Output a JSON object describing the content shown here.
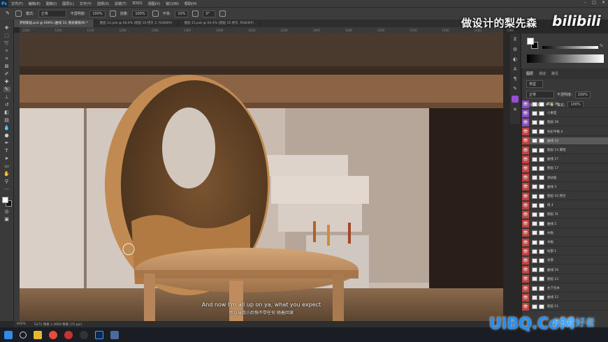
{
  "app": {
    "name": "Ps"
  },
  "menu": [
    "文件(F)",
    "编辑(E)",
    "图像(I)",
    "图层(L)",
    "文字(Y)",
    "选择(S)",
    "滤镜(T)",
    "3D(D)",
    "视图(V)",
    "窗口(W)",
    "帮助(H)"
  ],
  "options": {
    "mode_label": "模式:",
    "mode_value": "正常",
    "opacity_label": "不透明度:",
    "opacity_value": "100%",
    "flow_label": "流量:",
    "flow_value": "100%",
    "smooth_label": "平滑:",
    "smooth_value": "10%",
    "angle_value": "0°"
  },
  "tabs": [
    "梦想家居.psd @ 600% (曲线 10, 图层蒙版/8) *",
    "图层 14.psb @ 66.6% (图层 10 拷贝 2, RGB/8#)",
    "图层 15.psb @ 64.4% (图层 10 拷贝, RGB/8#)"
  ],
  "ruler": [
    "1280",
    "1300",
    "1320",
    "1340",
    "1360",
    "1380",
    "1400",
    "1420",
    "1440",
    "1460",
    "1480",
    "1500",
    "1520",
    "1540",
    "1560",
    "1580",
    "1600",
    "1620"
  ],
  "status": {
    "zoom": "600%",
    "doc": "5271 像素 x 3660 像素 (72 ppi)"
  },
  "subtitles": {
    "en": "And now I'm all up on ya, what you expect",
    "cn": "所以当我小后悔不带任何 随着回滚"
  },
  "watermark": {
    "text": "做设计的梨先森",
    "logo": "bilibili"
  },
  "color_panel": {
    "percent": "%",
    "fg": "#ffffff",
    "bg": "#000000"
  },
  "layers_panel": {
    "tabs": [
      "图层",
      "通道",
      "路径"
    ],
    "kind": "类型",
    "blend": "正常",
    "opacity_label": "不透明度:",
    "opacity_value": "100%",
    "lock_label": "锁定:",
    "fill_label": "填充:",
    "fill_value": "100%",
    "layers": [
      {
        "name": "图层 36",
        "sel": false
      },
      {
        "name": "小果是",
        "sel": false
      },
      {
        "name": "图层 28",
        "sel": false
      },
      {
        "name": "色彩平衡 4",
        "sel": false
      },
      {
        "name": "曲线 10",
        "sel": true
      },
      {
        "name": "图层 14 属性",
        "sel": false
      },
      {
        "name": "曲线 17",
        "sel": false
      },
      {
        "name": "图层 17",
        "sel": false
      },
      {
        "name": "调试板",
        "sel": false
      },
      {
        "name": "曲线 3",
        "sel": false
      },
      {
        "name": "图层 10 拷贝",
        "sel": false
      },
      {
        "name": "组 4",
        "sel": false
      },
      {
        "name": "图层 31",
        "sel": false
      },
      {
        "name": "曲线 5",
        "sel": false
      },
      {
        "name": "木板",
        "sel": false
      },
      {
        "name": "木板",
        "sel": false
      },
      {
        "name": "局部 1",
        "sel": false
      },
      {
        "name": "背景",
        "sel": false
      },
      {
        "name": "曲线 16",
        "sel": false
      },
      {
        "name": "图层 13",
        "sel": false
      },
      {
        "name": "左下包木",
        "sel": false
      },
      {
        "name": "曲线 12",
        "sel": false
      },
      {
        "name": "图层 11",
        "sel": false
      }
    ]
  },
  "watermark2": {
    "main": "UiBQ.CoM",
    "ps": "PS爱好者"
  }
}
